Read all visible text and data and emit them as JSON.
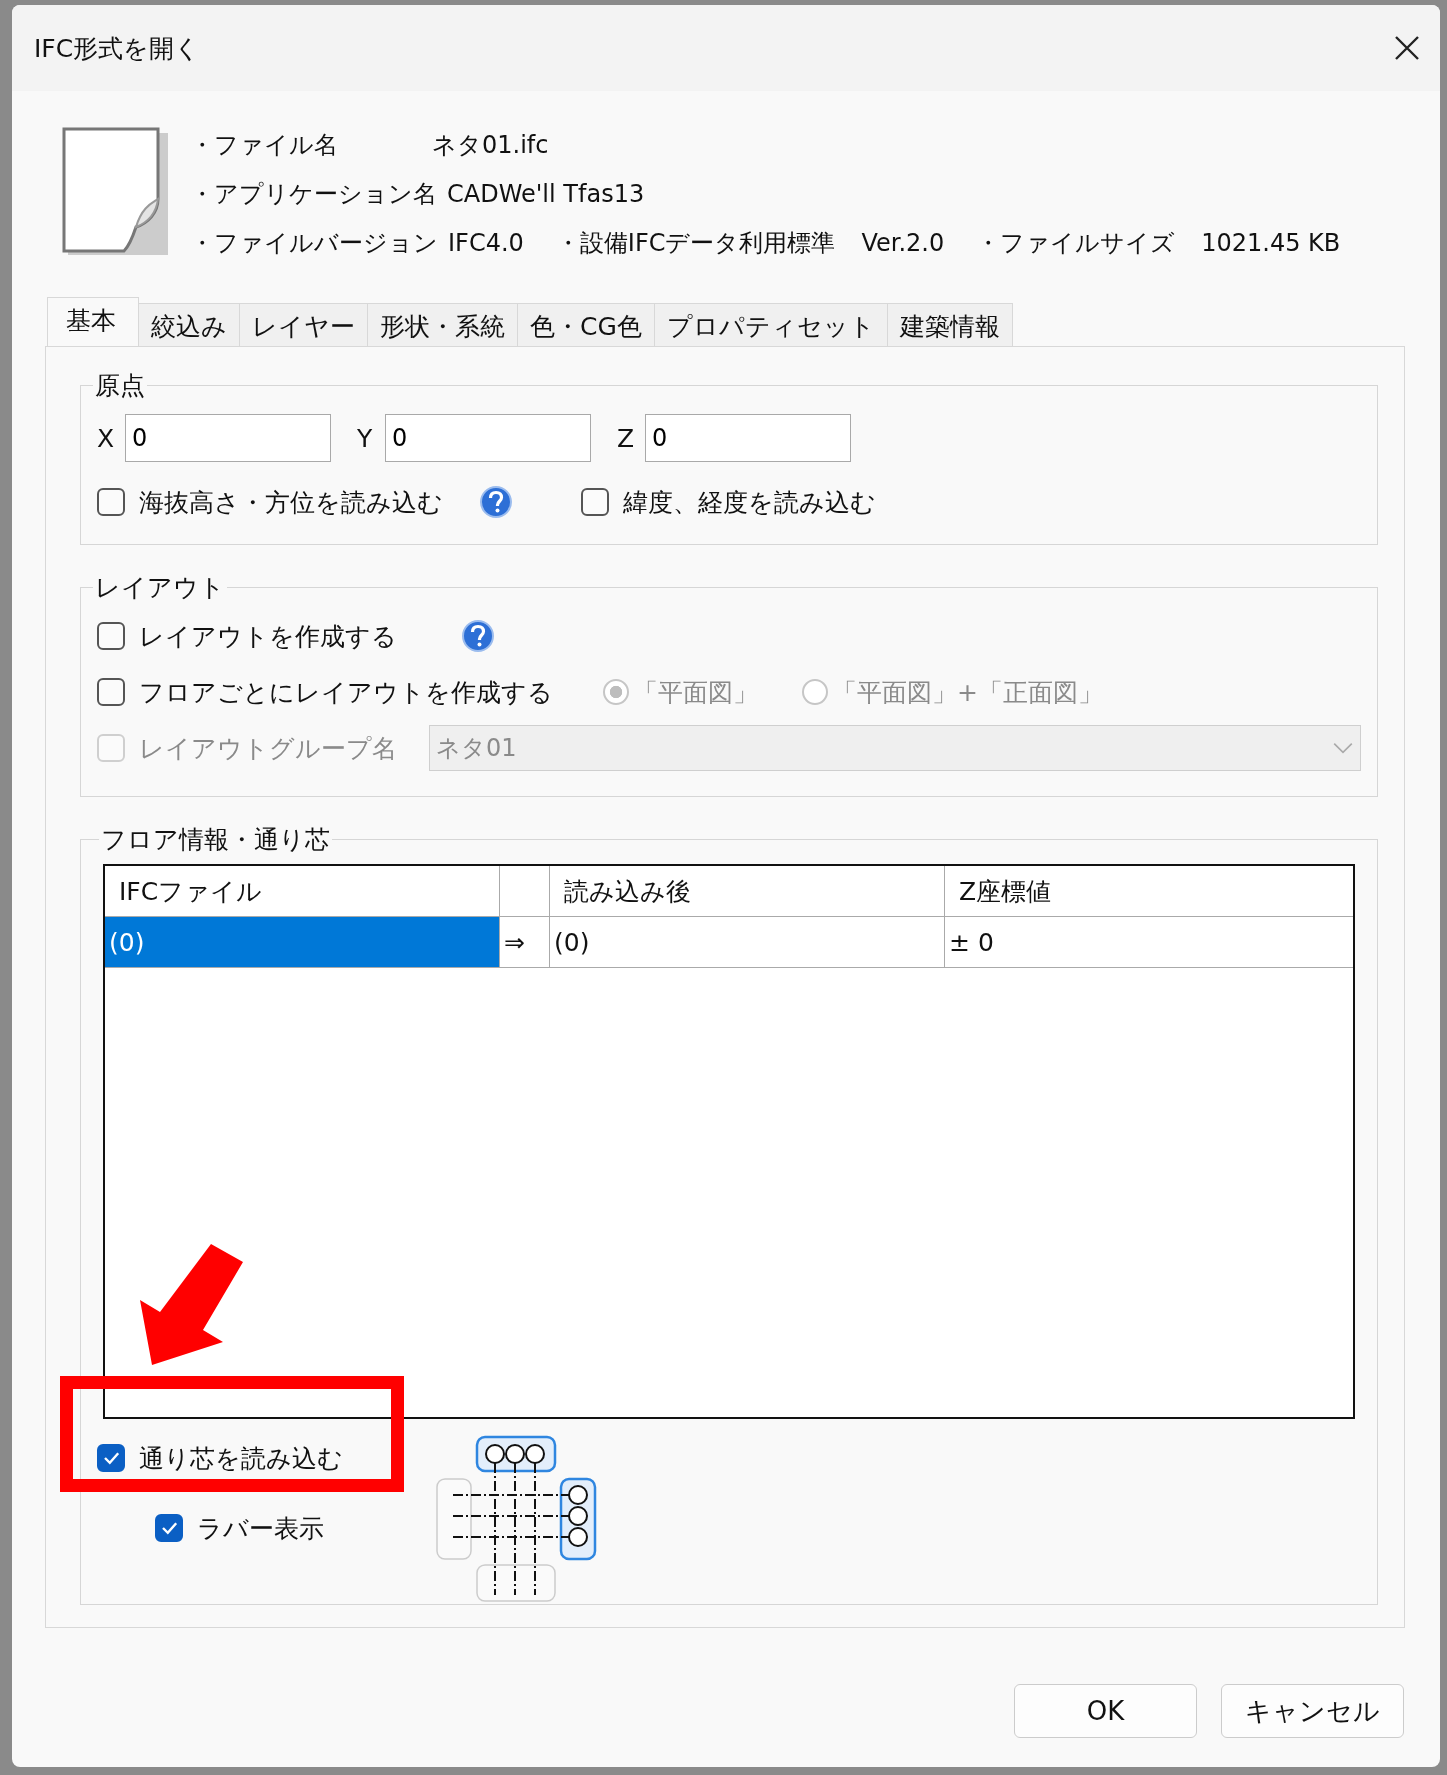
{
  "window": {
    "title": "IFC形式を開く"
  },
  "file_info": [
    {
      "items": [
        {
          "label": "・ファイル名",
          "value": "ネタ01.ifc"
        }
      ]
    },
    {
      "items": [
        {
          "label": "・アプリケーション名",
          "value": "CADWe'll Tfas13"
        }
      ]
    },
    {
      "items": [
        {
          "label": "・ファイルバージョン",
          "value": "IFC4.0"
        },
        {
          "label": "・設備IFCデータ利用標準",
          "value": "Ver.2.0"
        },
        {
          "label": "・ファイルサイズ",
          "value": "1021.45 KB"
        }
      ]
    }
  ],
  "tabs": [
    {
      "label": "基本",
      "selected": true
    },
    {
      "label": "絞込み",
      "selected": false
    },
    {
      "label": "レイヤー",
      "selected": false
    },
    {
      "label": "形状・系統",
      "selected": false
    },
    {
      "label": "色・CG色",
      "selected": false
    },
    {
      "label": "プロパティセット",
      "selected": false
    },
    {
      "label": "建築情報",
      "selected": false
    }
  ],
  "origin": {
    "title": "原点",
    "fields": [
      {
        "label": "X",
        "value": "0"
      },
      {
        "label": "Y",
        "value": "0"
      },
      {
        "label": "Z",
        "value": "0"
      }
    ],
    "options": [
      {
        "label": "海抜高さ・方位を読み込む",
        "checked": false,
        "help": true
      },
      {
        "label": "緯度、経度を読み込む",
        "checked": false,
        "help": false
      }
    ]
  },
  "layout": {
    "title": "レイアウト",
    "create": {
      "label": "レイアウトを作成する",
      "checked": false,
      "help": true
    },
    "per_floor": {
      "label": "フロアごとにレイアウトを作成する",
      "checked": false,
      "radios": [
        {
          "label": "「平面図」",
          "selected": true,
          "disabled": true
        },
        {
          "label": "「平面図」+「正面図」",
          "selected": false,
          "disabled": true
        }
      ]
    },
    "group_name": {
      "label": "レイアウトグループ名",
      "checked": false,
      "disabled": true,
      "value": "ネタ01"
    }
  },
  "floor": {
    "title": "フロア情報・通り芯",
    "columns": [
      {
        "kind": "text",
        "label": "IFCファイル"
      },
      {
        "kind": "arrow"
      },
      {
        "kind": "text",
        "label": "読み込み後"
      },
      {
        "kind": "text",
        "label": "Z座標値"
      }
    ],
    "rows": [
      {
        "selected": true,
        "cells": [
          "(0)",
          "⇒",
          "(0)",
          "± 0"
        ]
      }
    ],
    "grid": {
      "label": "通り芯を読み込む",
      "checked": true,
      "children": [
        {
          "label": "ラバー表示",
          "checked": true
        }
      ]
    }
  },
  "buttons": [
    {
      "label": "OK"
    },
    {
      "label": "キャンセル"
    }
  ]
}
